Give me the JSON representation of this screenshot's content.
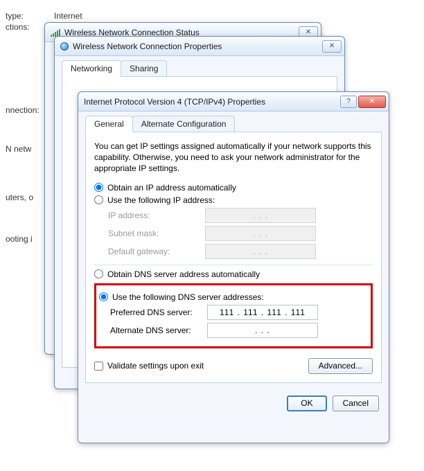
{
  "bg": {
    "type_label": "type:",
    "type_value": "Internet",
    "ctions_label": "ctions:",
    "nnection": "nnection:",
    "n_netw": "N netw",
    "uters": "uters, o",
    "ooting": "ooting i"
  },
  "status_win": {
    "title": "Wireless Network Connection Status"
  },
  "prop_win": {
    "title": "Wireless Network Connection Properties",
    "tabs": {
      "networking": "Networking",
      "sharing": "Sharing"
    }
  },
  "ip_win": {
    "title": "Internet Protocol Version 4 (TCP/IPv4) Properties",
    "tabs": {
      "general": "General",
      "alt": "Alternate Configuration"
    },
    "intro": "You can get IP settings assigned automatically if your network supports this capability. Otherwise, you need to ask your network administrator for the appropriate IP settings.",
    "radio_obtain_ip": "Obtain an IP address automatically",
    "radio_use_ip": "Use the following IP address:",
    "ip_address_label": "IP address:",
    "subnet_label": "Subnet mask:",
    "gateway_label": "Default gateway:",
    "radio_obtain_dns": "Obtain DNS server address automatically",
    "radio_use_dns": "Use the following DNS server addresses:",
    "pref_dns_label": "Preferred DNS server:",
    "alt_dns_label": "Alternate DNS server:",
    "pref_dns_value": "111 . 111 . 111 . 111",
    "alt_dns_value": ".       .       .",
    "ip_placeholder": ".       .       .",
    "validate": "Validate settings upon exit",
    "advanced": "Advanced...",
    "ok": "OK",
    "cancel": "Cancel"
  }
}
